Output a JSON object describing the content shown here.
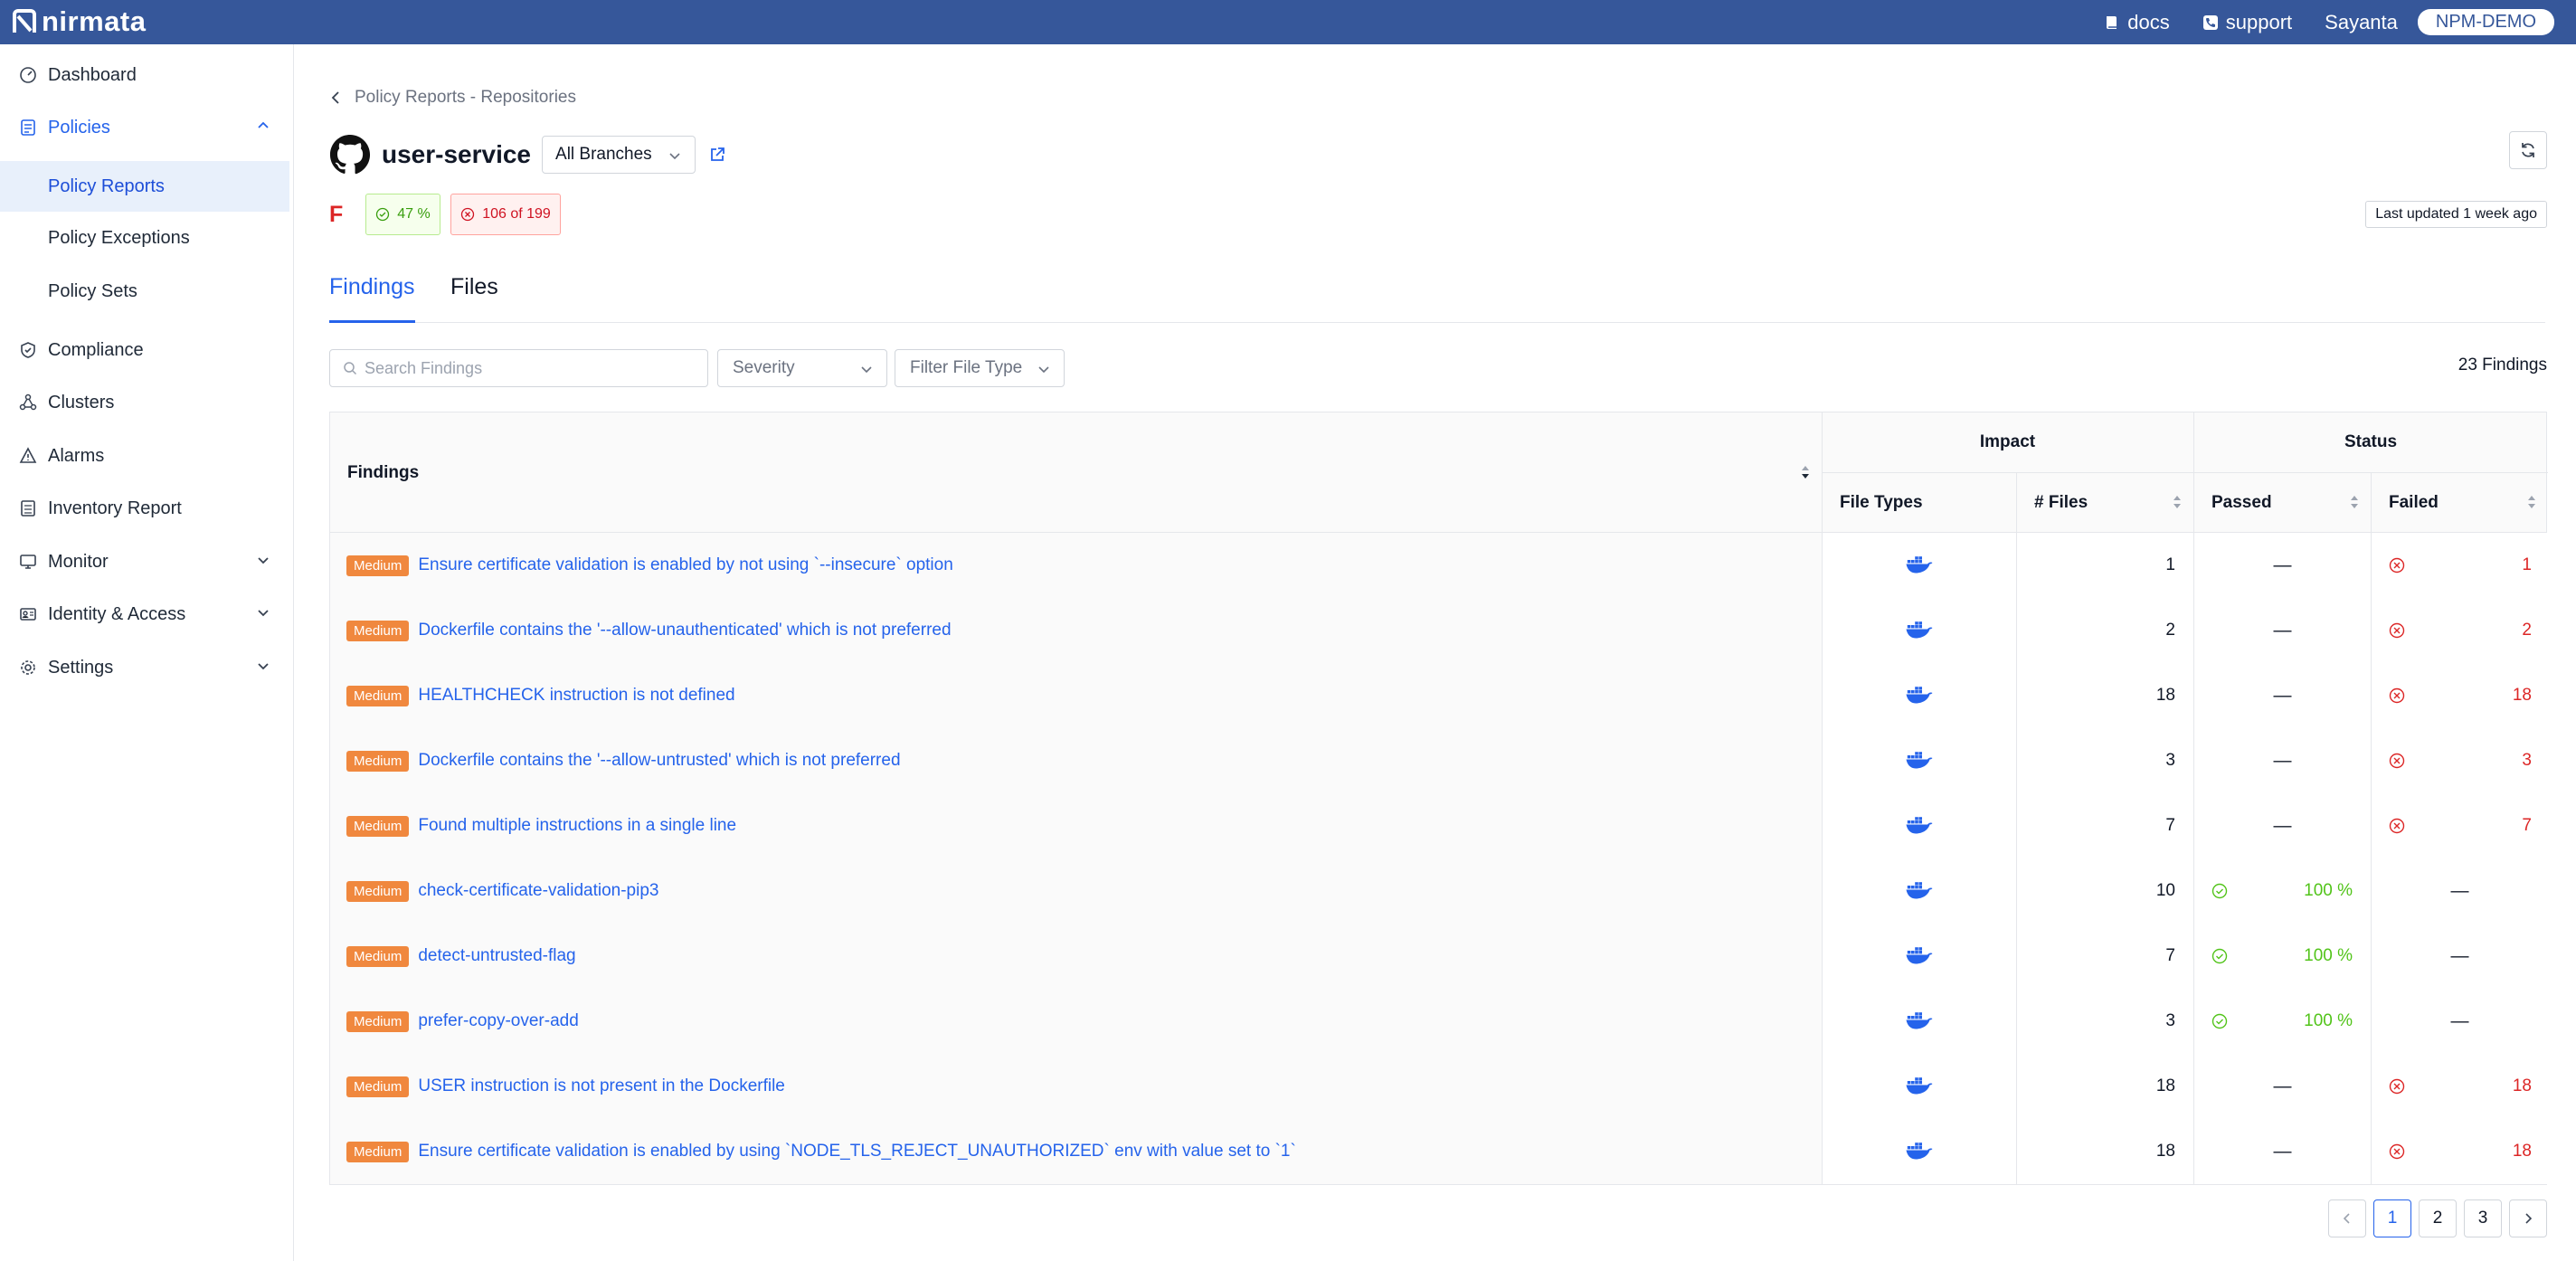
{
  "topbar": {
    "brand": "nirmata",
    "docs_label": "docs",
    "support_label": "support",
    "user_name": "Sayanta",
    "org_name": "NPM-DEMO"
  },
  "sidebar": {
    "items": [
      {
        "label": "Dashboard",
        "icon": "dashboard-icon"
      },
      {
        "label": "Policies",
        "icon": "policies-icon",
        "expanded": true
      },
      {
        "label": "Policy Reports",
        "selected": true
      },
      {
        "label": "Policy Exceptions"
      },
      {
        "label": "Policy Sets"
      },
      {
        "label": "Compliance",
        "icon": "shield-icon"
      },
      {
        "label": "Clusters",
        "icon": "clusters-icon"
      },
      {
        "label": "Alarms",
        "icon": "alarm-icon"
      },
      {
        "label": "Inventory Report",
        "icon": "inventory-icon"
      },
      {
        "label": "Monitor",
        "icon": "monitor-icon"
      },
      {
        "label": "Identity & Access",
        "icon": "identity-icon"
      },
      {
        "label": "Settings",
        "icon": "gear-icon"
      }
    ]
  },
  "header": {
    "breadcrumb": "Policy Reports - Repositories",
    "repo_name": "user-service",
    "branch": "All Branches",
    "grade": "F",
    "pass_percent": "47 %",
    "fail_summary": "106 of 199",
    "last_updated": "Last updated 1 week ago"
  },
  "tabs": [
    {
      "label": "Findings",
      "active": true
    },
    {
      "label": "Files",
      "active": false
    }
  ],
  "filters": {
    "search_placeholder": "Search Findings",
    "severity_label": "Severity",
    "file_type_label": "Filter File Type",
    "findings_count": "23 Findings"
  },
  "table": {
    "headers": {
      "findings": "Findings",
      "impact": "Impact",
      "status": "Status",
      "file_types": "File Types",
      "num_files": "# Files",
      "passed": "Passed",
      "failed": "Failed"
    },
    "rows": [
      {
        "severity": "Medium",
        "title": "Ensure certificate validation is enabled by not using `--insecure` option",
        "files": "1",
        "passed": "—",
        "failed": "1"
      },
      {
        "severity": "Medium",
        "title": "Dockerfile contains the '--allow-unauthenticated' which is not preferred",
        "files": "2",
        "passed": "—",
        "failed": "2"
      },
      {
        "severity": "Medium",
        "title": "HEALTHCHECK instruction is not defined",
        "files": "18",
        "passed": "—",
        "failed": "18"
      },
      {
        "severity": "Medium",
        "title": "Dockerfile contains the '--allow-untrusted' which is not preferred",
        "files": "3",
        "passed": "—",
        "failed": "3"
      },
      {
        "severity": "Medium",
        "title": "Found multiple instructions in a single line",
        "files": "7",
        "passed": "—",
        "failed": "7"
      },
      {
        "severity": "Medium",
        "title": "check-certificate-validation-pip3",
        "files": "10",
        "passed": "100 %",
        "failed": "—"
      },
      {
        "severity": "Medium",
        "title": "detect-untrusted-flag",
        "files": "7",
        "passed": "100 %",
        "failed": "—"
      },
      {
        "severity": "Medium",
        "title": "prefer-copy-over-add",
        "files": "3",
        "passed": "100 %",
        "failed": "—"
      },
      {
        "severity": "Medium",
        "title": "USER instruction is not present in the Dockerfile",
        "files": "18",
        "passed": "—",
        "failed": "18"
      },
      {
        "severity": "Medium",
        "title": "Ensure certificate validation is enabled by using `NODE_TLS_REJECT_UNAUTHORIZED` env with value set to `1`",
        "files": "18",
        "passed": "—",
        "failed": "18"
      }
    ]
  },
  "pagination": {
    "pages": [
      "1",
      "2",
      "3"
    ],
    "current": "1"
  },
  "colors": {
    "topbar": "#36579a",
    "accent": "#2563eb",
    "severity_medium": "#f0883e",
    "fail": "#dc2626",
    "pass": "#52c41a"
  }
}
